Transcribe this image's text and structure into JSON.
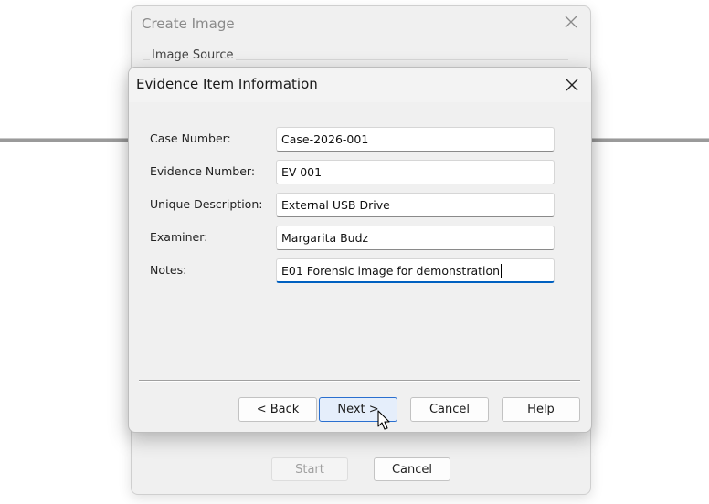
{
  "background_window": {
    "title": "Create Image",
    "group_label": "Image Source",
    "start_label": "Start",
    "cancel_label": "Cancel"
  },
  "dialog": {
    "title": "Evidence Item Information",
    "fields": [
      {
        "label": "Case Number:",
        "value": "Case-2026-001"
      },
      {
        "label": "Evidence Number:",
        "value": "EV-001"
      },
      {
        "label": "Unique Description:",
        "value": "External USB Drive"
      },
      {
        "label": "Examiner:",
        "value": "Margarita Budz"
      },
      {
        "label": "Notes:",
        "value": "E01 Forensic image for demonstration"
      }
    ],
    "buttons": {
      "back": "< Back",
      "next": "Next >",
      "cancel": "Cancel",
      "help": "Help"
    }
  },
  "icons": {
    "close": "close-icon",
    "cursor": "mouse-pointer-icon"
  },
  "colors": {
    "focus_underline": "#0060c0",
    "primary_button_border": "#2a6fcf"
  }
}
